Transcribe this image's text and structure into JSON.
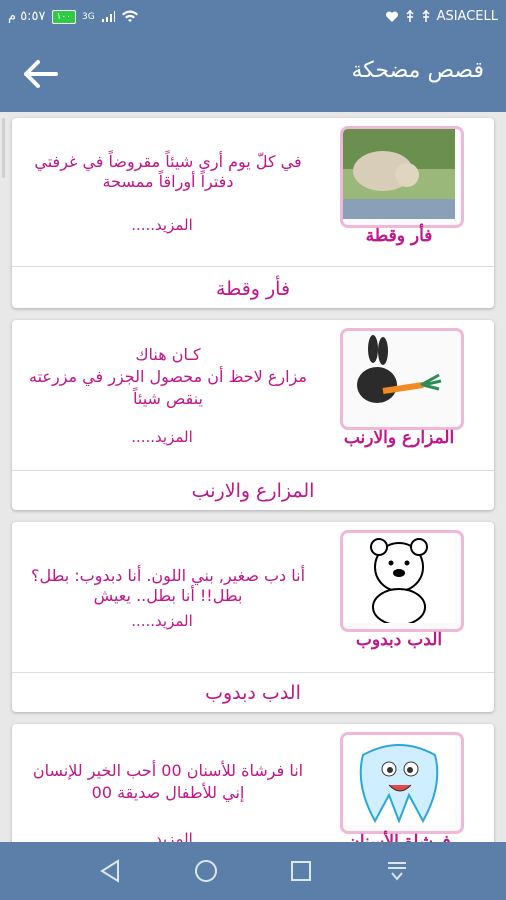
{
  "status": {
    "time": "٥:٥٧ م",
    "battery": "١٠٠",
    "network": "3G",
    "carrier": "ASIACELL"
  },
  "appbar": {
    "title": "قصص مضحكة"
  },
  "stories": [
    {
      "excerpt": "في كلّ يوم أرى شيئاً مقروضاً في غرفتي دفتراً أوراقاً ممسحة",
      "more": "المزيد.....",
      "caption": "فأر وقطة",
      "title": "فأر وقطة"
    },
    {
      "excerpt": "كـان هناك\nمزارع لاحظ أن محصول الجزر في مزرعته ينقص شيئاً",
      "more": "المزيد.....",
      "caption": "المزارع والارنب",
      "title": "المزارع والارنب"
    },
    {
      "excerpt": "أنا دب صغير, بني اللون. أنا دبدوب: بطل؟ بطل!! أنا بطل.. يعيش",
      "more": "المزيد.....",
      "caption": "الدب دبدوب",
      "title": "الدب دبدوب"
    },
    {
      "excerpt": "انا فرشاة للأسنان 00 أحب الخير للإنسان\nإني للأطفال صديقة 00",
      "more": "المزيد.....",
      "caption": "فرشاة الأسنان",
      "title": ""
    }
  ],
  "icons": {
    "back": "arrow-left-icon",
    "nav_back": "triangle-back-icon",
    "nav_home": "circle-home-icon",
    "nav_recents": "square-recents-icon",
    "nav_menu": "notification-menu-icon"
  },
  "colors": {
    "primary": "#5b7fa8",
    "accent": "#c0168a"
  }
}
